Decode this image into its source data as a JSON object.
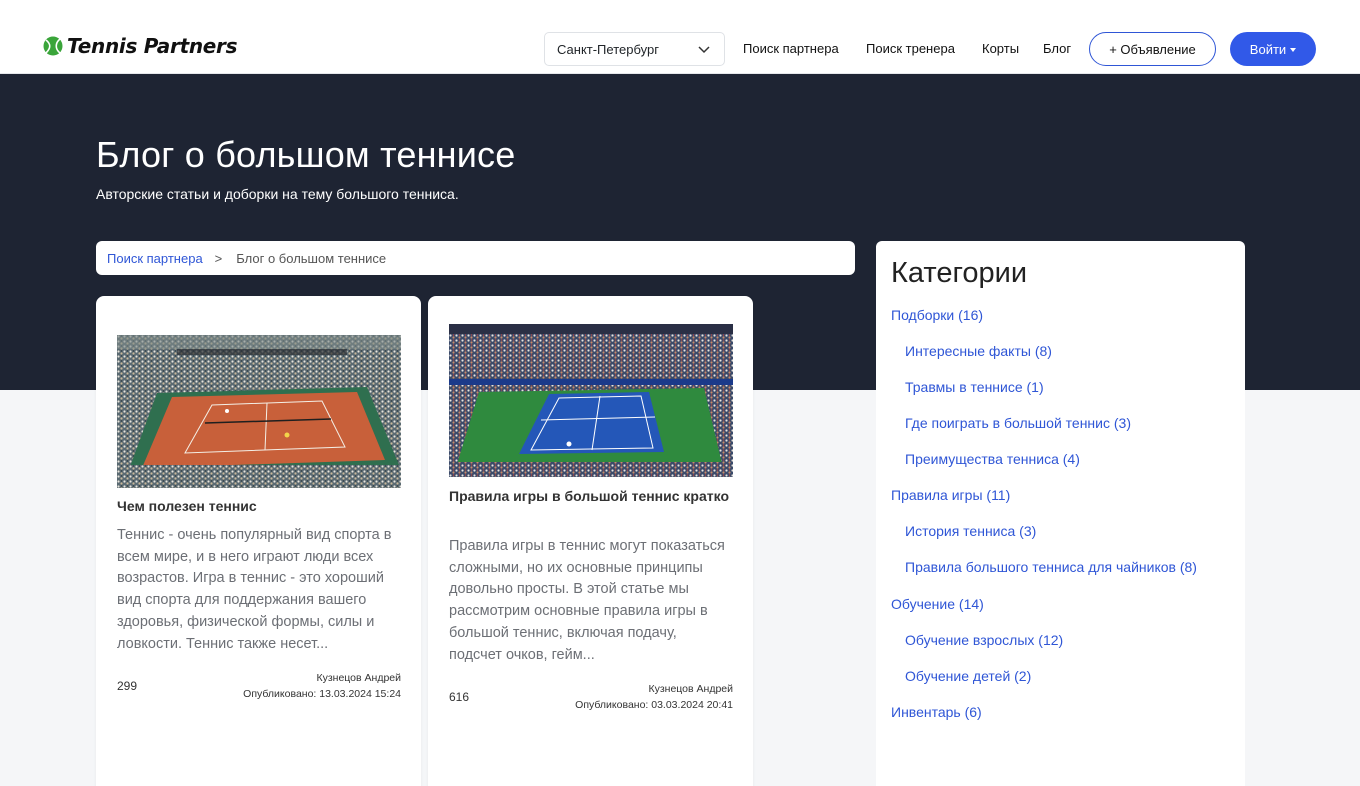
{
  "header": {
    "logo_text": "Tennis Partners",
    "city": "Санкт-Петербург",
    "nav": [
      "Поиск партнера",
      "Поиск тренера",
      "Корты",
      "Блог"
    ],
    "ad_button": "+ Объявление",
    "login_button": "Войти",
    "accent_color": "#3159e8"
  },
  "hero": {
    "title": "Блог о большом теннисе",
    "subtitle": "Авторские статьи и доборки на тему большого тенниса."
  },
  "breadcrumb": {
    "link": "Поиск партнера",
    "separator": ">",
    "current": "Блог о большом теннисе"
  },
  "posts": [
    {
      "title": "Чем полезен теннис",
      "excerpt": "Теннис - очень популярный вид спорта в всем мире, и в него играют люди всех возрастов. Игра в теннис - это хороший вид спорта для поддержания вашего здоровья, физической формы, силы и ловкости. Теннис также несет...",
      "views": "299",
      "author": "Кузнецов Андрей",
      "published": "Опубликовано: 13.03.2024 15:24",
      "image": "clay-court-stadium"
    },
    {
      "title": "Правила игры в большой теннис кратко",
      "excerpt": "Правила игры в теннис могут показаться сложными, но их основные принципы довольно просты. В этой статье мы рассмотрим основные правила игры в большой теннис, включая подачу, подсчет очков, гейм...",
      "views": "616",
      "author": "Кузнецов Андрей",
      "published": "Опубликовано: 03.03.2024 20:41",
      "image": "hard-court-stadium"
    }
  ],
  "sidebar": {
    "title": "Категории",
    "categories": [
      {
        "label": "Подборки (16)",
        "level": 0
      },
      {
        "label": "Интересные факты (8)",
        "level": 1
      },
      {
        "label": "Травмы в теннисе (1)",
        "level": 1
      },
      {
        "label": "Где поиграть в большой теннис (3)",
        "level": 1
      },
      {
        "label": "Преимущества тенниса (4)",
        "level": 1
      },
      {
        "label": "Правила игры (11)",
        "level": 0
      },
      {
        "label": "История тенниса (3)",
        "level": 1
      },
      {
        "label": "Правила большого тенниса для чайников (8)",
        "level": 1
      },
      {
        "label": "Обучение (14)",
        "level": 0
      },
      {
        "label": "Обучение взрослых (12)",
        "level": 1
      },
      {
        "label": "Обучение детей (2)",
        "level": 1
      },
      {
        "label": "Инвентарь (6)",
        "level": 0
      }
    ]
  }
}
